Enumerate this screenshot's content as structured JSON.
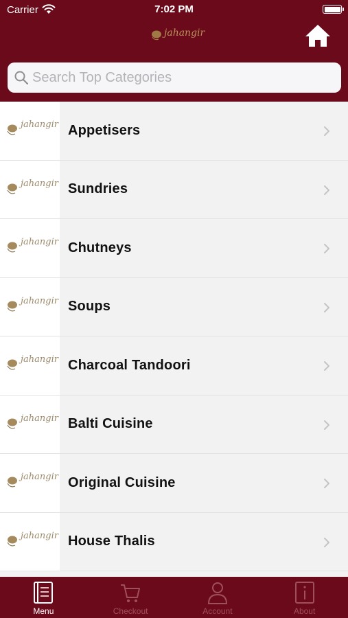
{
  "status_bar": {
    "carrier": "Carrier",
    "time": "7:02 PM"
  },
  "header": {
    "logo_text": "jahangir",
    "home_icon": "home-icon"
  },
  "search": {
    "placeholder": "Search Top Categories",
    "value": ""
  },
  "categories": [
    {
      "label": "Appetisers",
      "thumb_text": "jahangir"
    },
    {
      "label": "Sundries",
      "thumb_text": "jahangir"
    },
    {
      "label": "Chutneys",
      "thumb_text": "jahangir"
    },
    {
      "label": "Soups",
      "thumb_text": "jahangir"
    },
    {
      "label": "Charcoal Tandoori",
      "thumb_text": "jahangir"
    },
    {
      "label": "Balti Cuisine",
      "thumb_text": "jahangir"
    },
    {
      "label": "Original Cuisine",
      "thumb_text": "jahangir"
    },
    {
      "label": "House Thalis",
      "thumb_text": "jahangir"
    }
  ],
  "tabs": [
    {
      "label": "Menu",
      "icon": "menu-book-icon",
      "active": true
    },
    {
      "label": "Checkout",
      "icon": "cart-icon",
      "active": false
    },
    {
      "label": "Account",
      "icon": "person-icon",
      "active": false
    },
    {
      "label": "About",
      "icon": "info-icon",
      "active": false
    }
  ],
  "colors": {
    "brand": "#6b0a1a",
    "gold": "#b8925a",
    "list_bg": "#f2f2f2",
    "tab_inactive": "#a0505a"
  }
}
